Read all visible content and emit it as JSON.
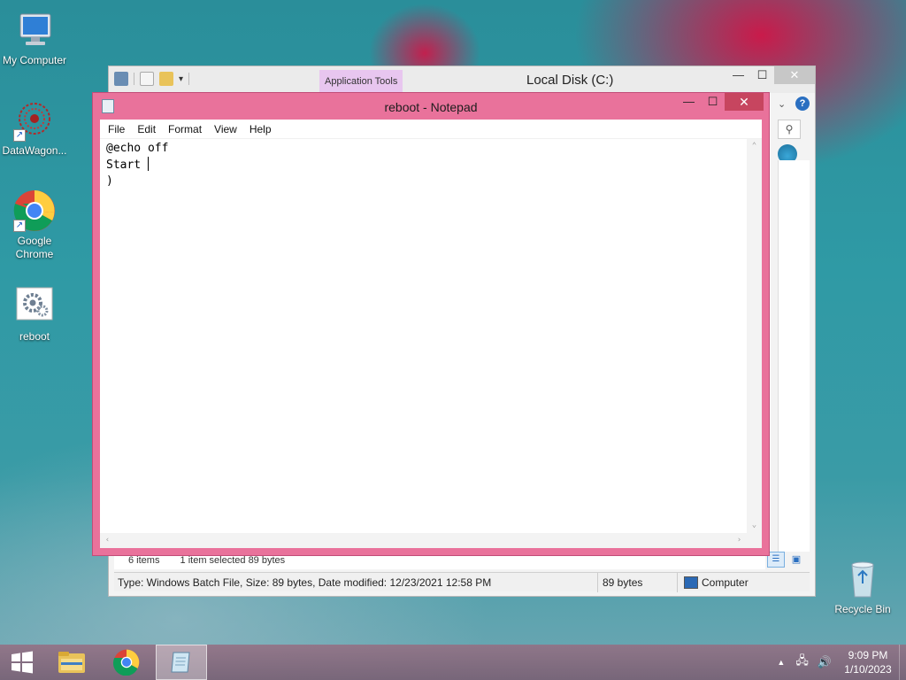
{
  "desktop": {
    "icons": [
      {
        "label": "My Computer",
        "icon": "computer-icon"
      },
      {
        "label": "DataWagon...",
        "icon": "datawagon-icon"
      },
      {
        "label": "Google Chrome",
        "icon": "chrome-icon"
      },
      {
        "label": "reboot",
        "icon": "batch-file-icon"
      },
      {
        "label": "Recycle Bin",
        "icon": "recycle-bin-icon"
      }
    ]
  },
  "explorer": {
    "context_tab": "Application Tools",
    "title": "Local Disk (C:)",
    "item_count": "6 items",
    "selection": "1 item selected  89 bytes",
    "status": "Type: Windows Batch File, Size: 89 bytes, Date modified: 12/23/2021 12:58 PM",
    "status_size": "89 bytes",
    "status_location": "Computer"
  },
  "notepad": {
    "title": "reboot - Notepad",
    "menu": [
      "File",
      "Edit",
      "Format",
      "View",
      "Help"
    ],
    "lines": [
      "@echo off",
      "Start ",
      ")"
    ]
  },
  "taskbar": {
    "time": "9:09 PM",
    "date": "1/10/2023"
  },
  "colors": {
    "notepad_frame": "#e9729b",
    "close_button": "#c7455f",
    "app_tools_tab": "#e8c6ef"
  }
}
